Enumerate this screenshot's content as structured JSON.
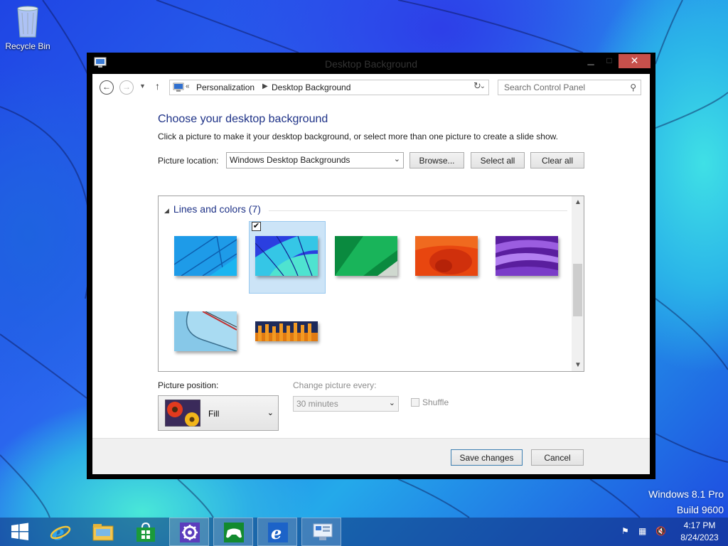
{
  "desktop": {
    "recycle_bin_label": "Recycle Bin",
    "watermark_line1": "Windows 8.1 Pro",
    "watermark_line2": "Build 9600"
  },
  "window": {
    "title": "Desktop Background",
    "address": {
      "prefix": "«",
      "crumbs": [
        "Personalization",
        "Desktop Background"
      ]
    },
    "search_placeholder": "Search Control Panel"
  },
  "content": {
    "heading": "Choose your desktop background",
    "description": "Click a picture to make it your desktop background, or select more than one picture to create a slide show.",
    "picture_location_label": "Picture location:",
    "picture_location_value": "Windows Desktop Backgrounds",
    "browse_label": "Browse...",
    "select_all_label": "Select all",
    "clear_all_label": "Clear all",
    "group_label": "Lines and colors (7)",
    "pictures": [
      {
        "name": "blue-lines",
        "selected": false
      },
      {
        "name": "blue-petals",
        "selected": true
      },
      {
        "name": "green-fold",
        "selected": false
      },
      {
        "name": "orange-swirl",
        "selected": false
      },
      {
        "name": "purple-waves",
        "selected": false
      },
      {
        "name": "light-blue-curve",
        "selected": false
      },
      {
        "name": "orange-fence",
        "selected": false
      }
    ],
    "picture_position_label": "Picture position:",
    "picture_position_value": "Fill",
    "change_picture_label": "Change picture every:",
    "change_picture_value": "30 minutes",
    "shuffle_label": "Shuffle"
  },
  "footer": {
    "save_label": "Save changes",
    "cancel_label": "Cancel"
  },
  "taskbar": {
    "items": [
      "start-icon",
      "internet-explorer-icon",
      "file-explorer-icon",
      "store-icon",
      "settings-icon",
      "games-icon",
      "internet-explorer-icon",
      "control-panel-icon"
    ],
    "clock_time": "4:17 PM",
    "clock_date": "8/24/2023"
  },
  "colors": {
    "accent": "#1e3287",
    "close_button": "#c7504b",
    "selection": "#cce4f7"
  }
}
